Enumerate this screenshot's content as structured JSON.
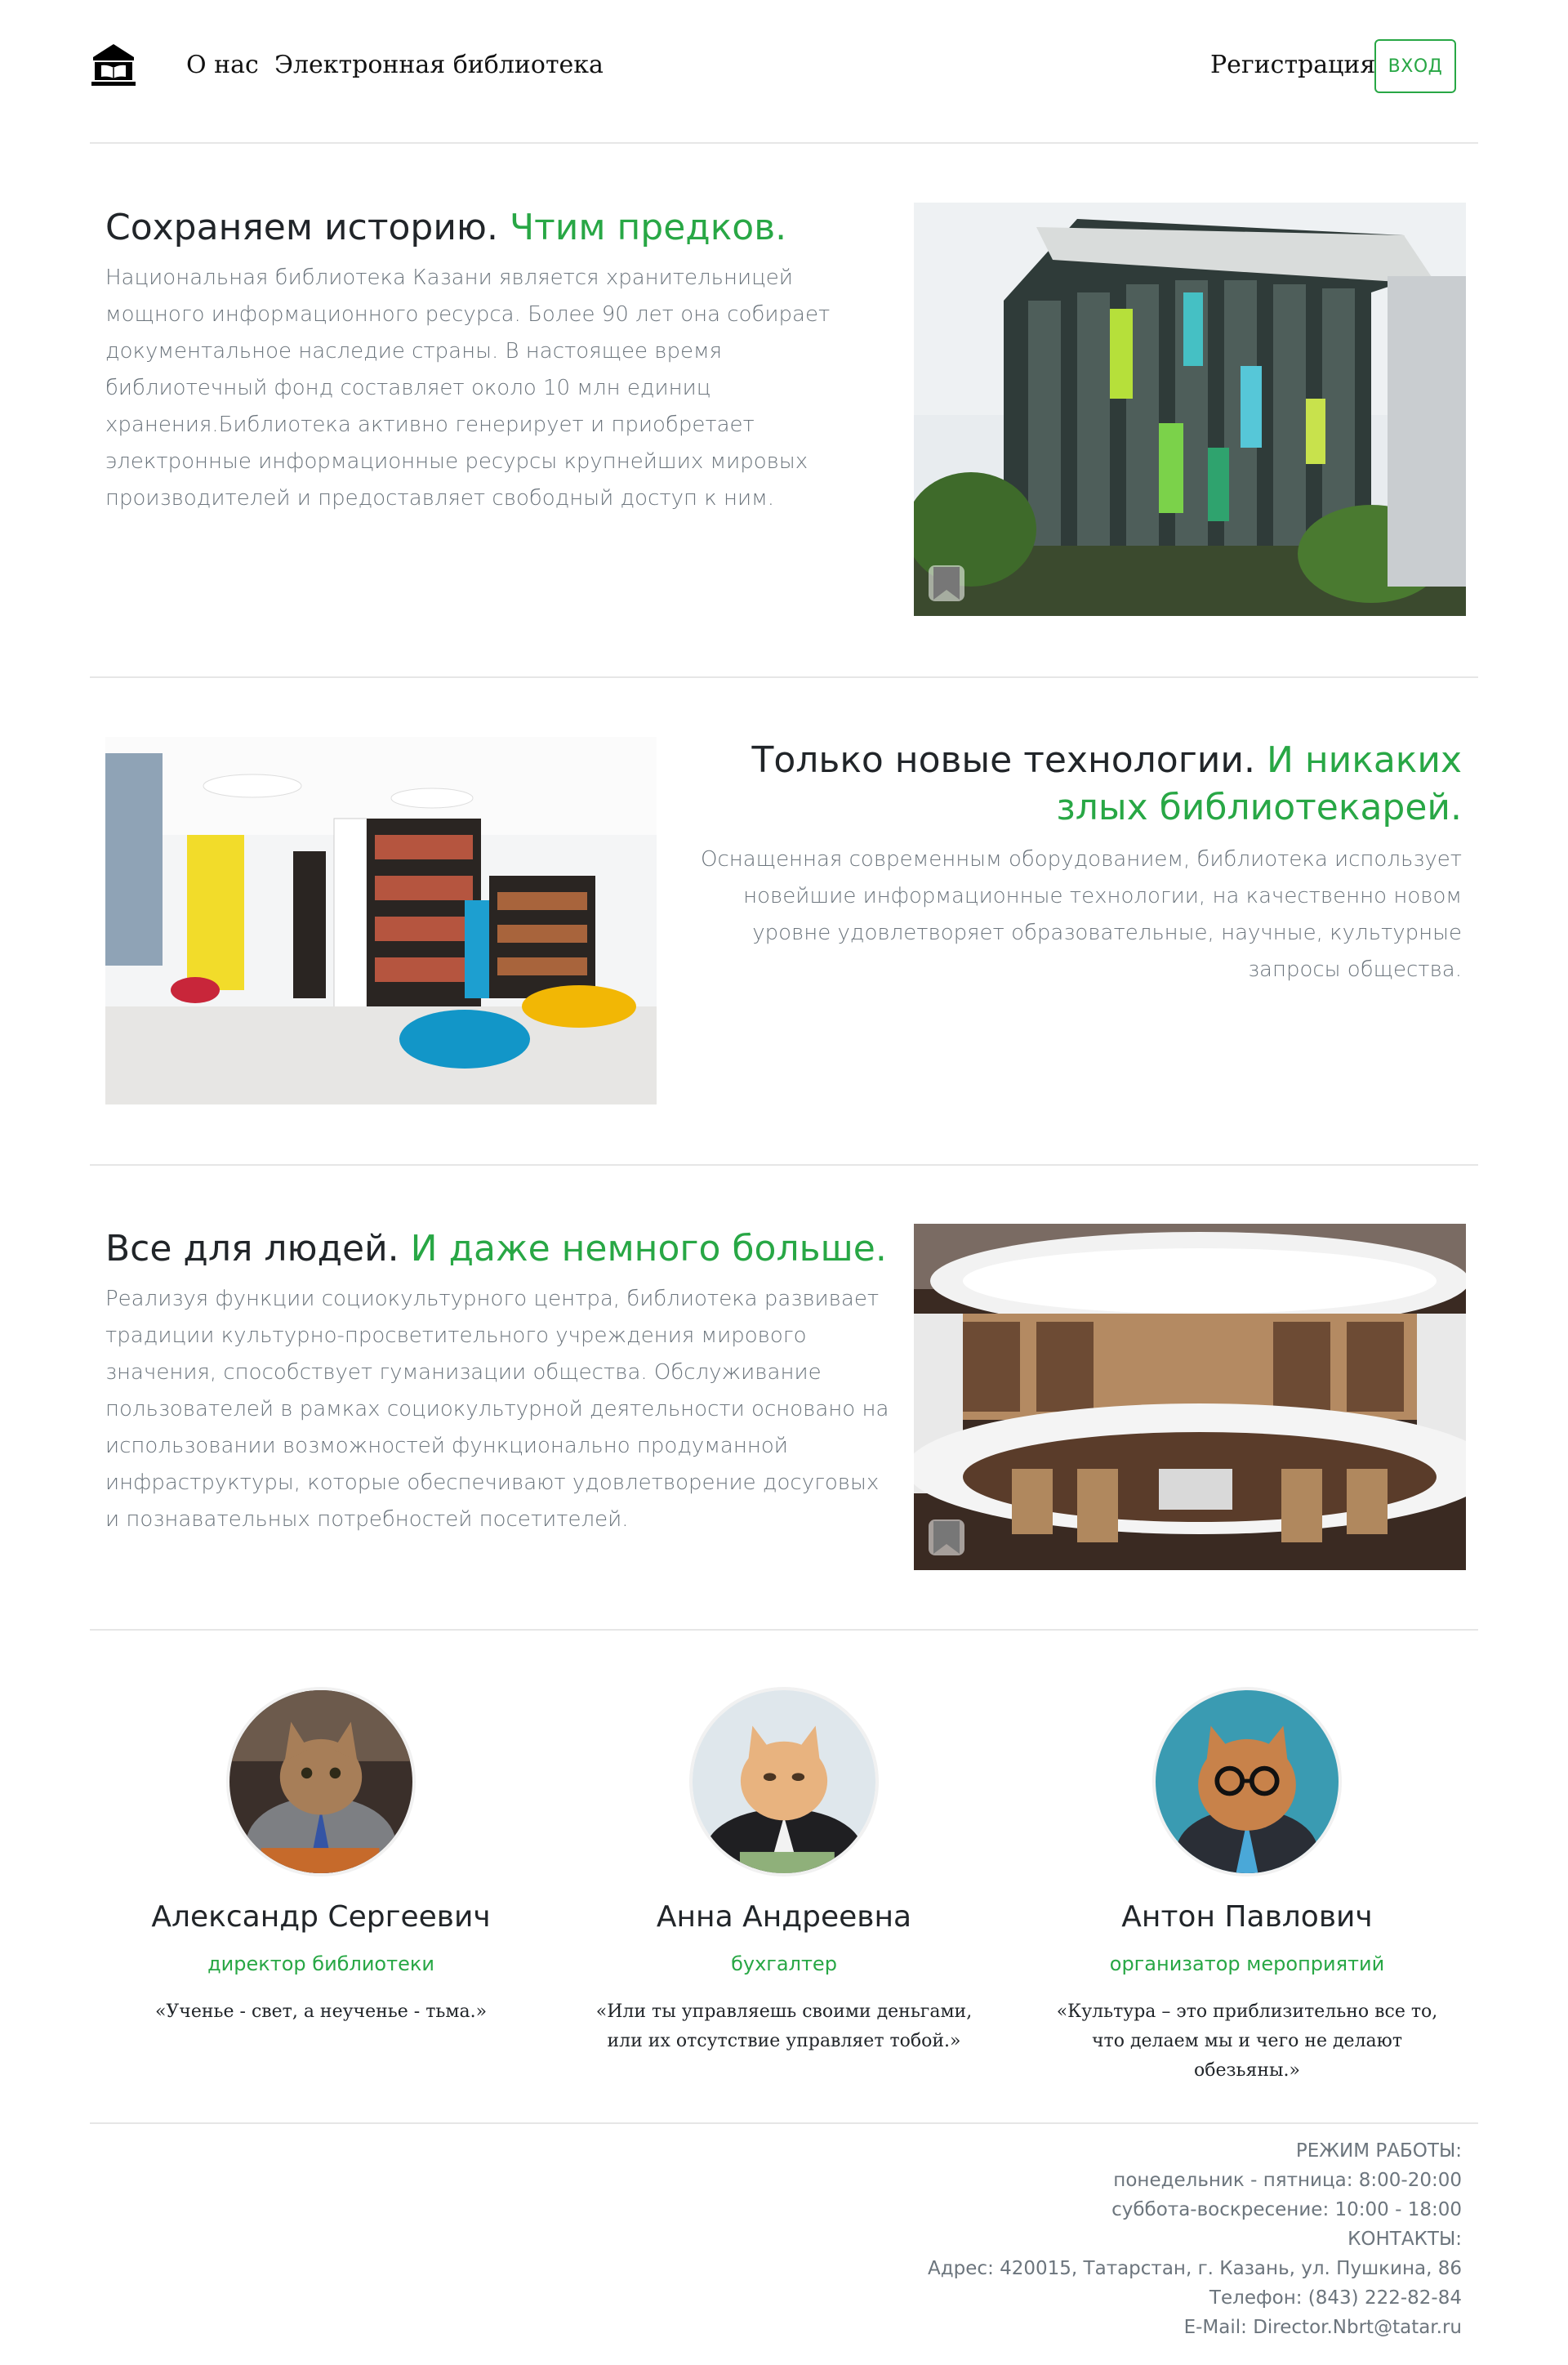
{
  "header": {
    "logo_icon": "library-building-icon",
    "nav": [
      "О нас",
      "Электронная библиотека"
    ],
    "register_label": "Регистрация",
    "login_label": "ВХОД"
  },
  "accent_color": "#28a745",
  "sections": [
    {
      "title": "Сохраняем историю.",
      "title_accent": "Чтим предков.",
      "text": "Национальная библиотека Казани является хранительницей мощного информационного ресурса. Более 90 лет она собирает документальное наследие страны. В настоящее время библиотечный фонд составляет около 10 млн единиц хранения.Библиотека активно генерирует и приобретает электронные информационные ресурсы крупнейших мировых производителей и предоставляет свободный доступ к ним."
    },
    {
      "title": "Только новые технологии.",
      "title_accent": "И никаких злых библиотекарей.",
      "text": "Оснащенная современным оборудованием, библиотека использует новейшие информационные технологии, на качественно новом уровне удовлетворяет образовательные, научные, культурные запросы общества."
    },
    {
      "title": "Все для людей.",
      "title_accent": "И даже немного больше.",
      "text": "Реализуя функции социокультурного центра, библиотека развивает традиции культурно-просветительного учреждения мирового значения, способствует гуманизации общества. Обслуживание пользователей в рамках социокультурной деятельности основано на использовании возможностей функционально продуманной инфраструктуры, которые обеспечивают удовлетворение досуговых и познавательных потребностей посетителей."
    }
  ],
  "staff": [
    {
      "name": "Александр Сергеевич",
      "role": "директор библиотеки",
      "quote": "«Ученье - свет, а неученье - тьма.»"
    },
    {
      "name": "Анна Андреевна",
      "role": "бухгалтер",
      "quote": "«Или ты управляешь своими деньгами, или их отсутствие управляет тобой.»"
    },
    {
      "name": "Антон Павлович",
      "role": "организатор мероприятий",
      "quote": "«Культура – это приблизительно все то, что делаем мы и чего не делают обезьяны.»"
    }
  ],
  "footer": {
    "lines": [
      "РЕЖИМ РАБОТЫ:",
      "понедельник - пятница: 8:00-20:00",
      "суббота-воскресение: 10:00 - 18:00",
      "КОНТАКТЫ:",
      "Адрес: 420015, Татарстан, г. Казань, ул. Пушкина, 86",
      "Телефон: (843) 222-82-84",
      "E-Mail: Director.Nbrt@tatar.ru"
    ]
  }
}
